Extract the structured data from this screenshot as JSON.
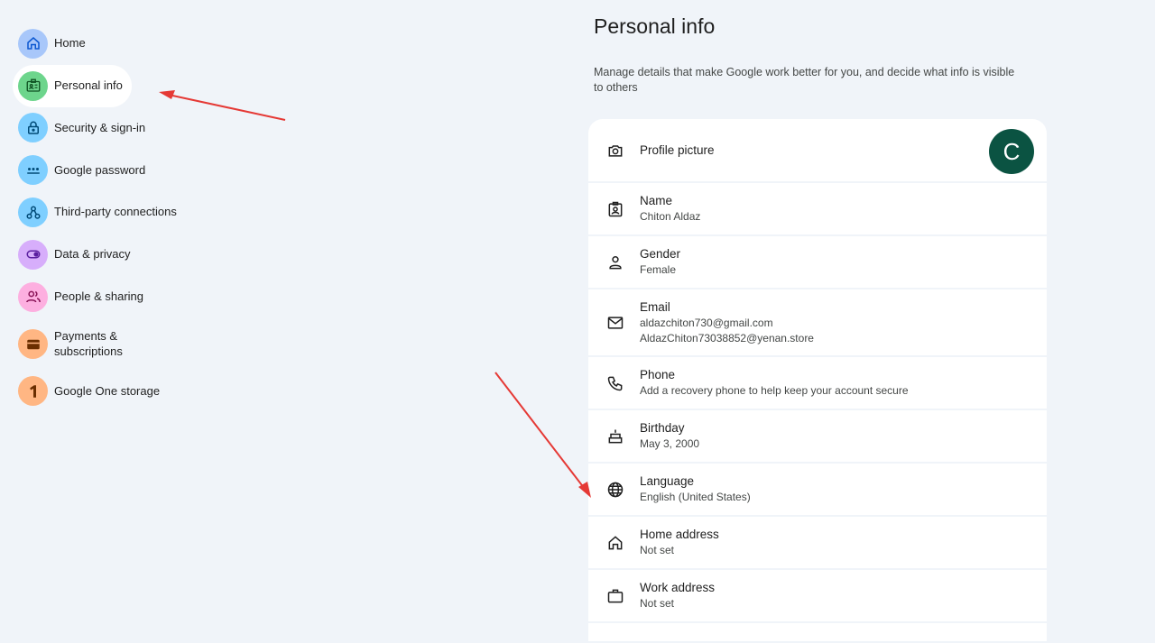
{
  "sidebar": {
    "items": [
      {
        "label": "Home",
        "icon": "home-icon",
        "color": "#a8c7fa",
        "iconColor": "#0b57d0"
      },
      {
        "label": "Personal info",
        "icon": "id-card-icon",
        "color": "#6dd58c",
        "iconColor": "#0f5223",
        "active": true
      },
      {
        "label": "Security & sign-in",
        "icon": "lock-icon",
        "color": "#7fcfff",
        "iconColor": "#004a77"
      },
      {
        "label": "Google password",
        "icon": "password-icon",
        "color": "#7fcfff",
        "iconColor": "#004a77"
      },
      {
        "label": "Third-party connections",
        "icon": "connections-icon",
        "color": "#7fcfff",
        "iconColor": "#004a77"
      },
      {
        "label": "Data & privacy",
        "icon": "toggle-icon",
        "color": "#d7aefb",
        "iconColor": "#5b1fa0"
      },
      {
        "label": "People & sharing",
        "icon": "people-icon",
        "color": "#fdafe0",
        "iconColor": "#8a1457"
      },
      {
        "label": "Payments & subscriptions",
        "icon": "wallet-icon",
        "color": "#ffb683",
        "iconColor": "#6a2e00"
      },
      {
        "label": "Google One storage",
        "icon": "google-one-icon",
        "color": "#ffb683",
        "iconColor": "#6a2e00"
      }
    ]
  },
  "main": {
    "title": "Personal info",
    "description": "Manage details that make Google work better for you, and decide what info is visible to others",
    "profile": {
      "label": "Profile picture",
      "avatar_letter": "C",
      "avatar_color": "#0b5342"
    },
    "rows": [
      {
        "title": "Name",
        "values": [
          "Chiton Aldaz"
        ],
        "icon": "badge-icon"
      },
      {
        "title": "Gender",
        "values": [
          "Female"
        ],
        "icon": "person-icon"
      },
      {
        "title": "Email",
        "values": [
          "aldazchiton730@gmail.com",
          "AldazChiton73038852@yenan.store"
        ],
        "icon": "mail-icon"
      },
      {
        "title": "Phone",
        "values": [
          "Add a recovery phone to help keep your account secure"
        ],
        "icon": "phone-icon"
      },
      {
        "title": "Birthday",
        "values": [
          "May 3, 2000"
        ],
        "icon": "cake-icon"
      },
      {
        "title": "Language",
        "values": [
          "English (United States)"
        ],
        "icon": "globe-icon"
      },
      {
        "title": "Home address",
        "values": [
          "Not set"
        ],
        "icon": "home-icon"
      },
      {
        "title": "Work address",
        "values": [
          "Not set"
        ],
        "icon": "briefcase-icon"
      }
    ]
  },
  "colors": {
    "background": "#f0f4f9",
    "annotation_arrow": "#e53935"
  }
}
